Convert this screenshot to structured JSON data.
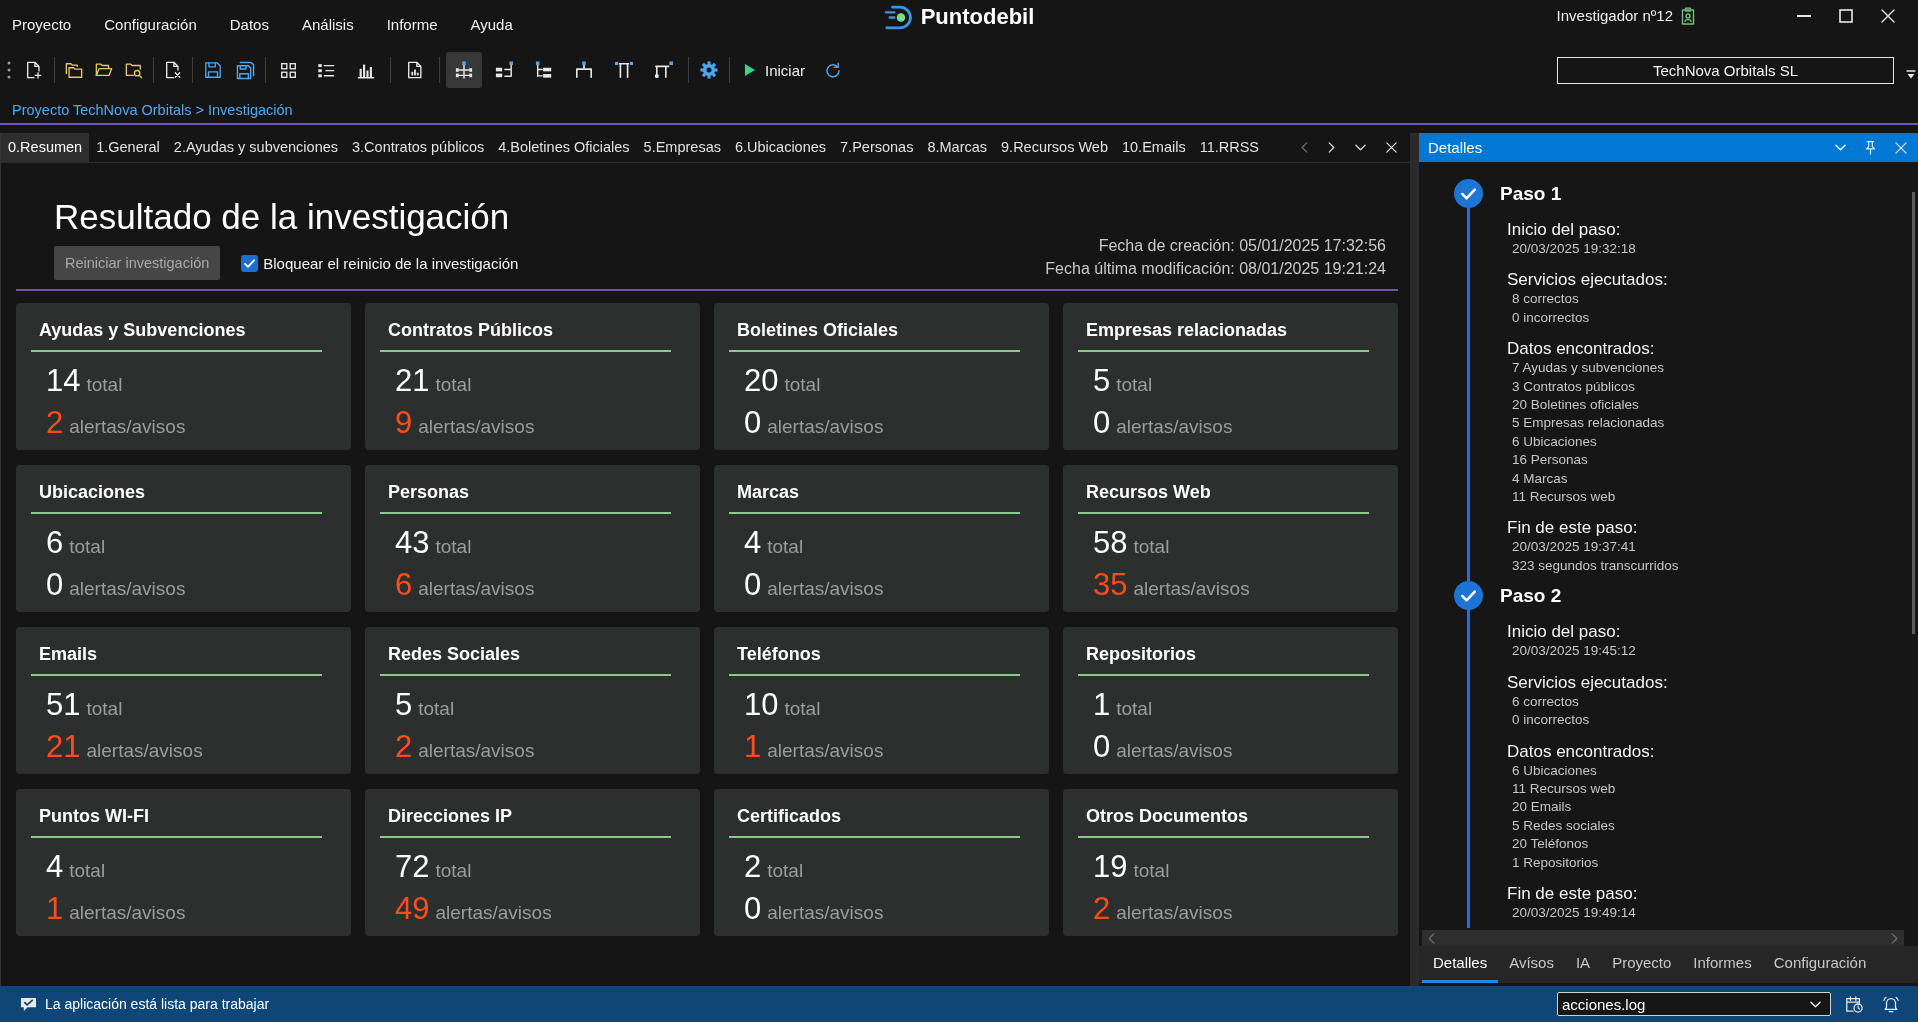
{
  "menu": [
    "Proyecto",
    "Configuración",
    "Datos",
    "Análisis",
    "Informe",
    "Ayuda"
  ],
  "logo": {
    "text": "Puntodebil"
  },
  "user": {
    "label": "Investigador nº12"
  },
  "toolbar": {
    "layout_buttons": [
      {
        "selected": true
      },
      {
        "selected": false
      },
      {
        "selected": false
      },
      {
        "selected": false
      },
      {
        "selected": false
      },
      {
        "selected": false
      }
    ],
    "start_button": {
      "label": "Iniciar"
    }
  },
  "company_selector": {
    "value": "TechNova Orbitals SL"
  },
  "breadcrumb": "Proyecto TechNova Orbitals > Investigación",
  "document_tabs": [
    {
      "label": "0.Resumen",
      "selected": true
    },
    {
      "label": "1.General",
      "selected": false
    },
    {
      "label": "2.Ayudas y subvenciones",
      "selected": false
    },
    {
      "label": "3.Contratos públicos",
      "selected": false
    },
    {
      "label": "4.Boletines Oficiales",
      "selected": false
    },
    {
      "label": "5.Empresas",
      "selected": false
    },
    {
      "label": "6.Ubicaciones",
      "selected": false
    },
    {
      "label": "7.Personas",
      "selected": false
    },
    {
      "label": "8.Marcas",
      "selected": false
    },
    {
      "label": "9.Recursos Web",
      "selected": false
    },
    {
      "label": "10.Emails",
      "selected": false
    },
    {
      "label": "11.RRSS",
      "selected": false
    }
  ],
  "summary": {
    "title": "Resultado de la investigación",
    "restart_button": {
      "label": "Reiniciar investigación",
      "disabled": true
    },
    "lock_checkbox": {
      "label": "Bloquear el reinicio de la investigación",
      "checked": true
    },
    "created": "Fecha de creación: 05/01/2025 17:32:56",
    "modified": "Fecha última modificación: 08/01/2025 19:21:24",
    "cards": [
      {
        "title": "Ayudas y Subvenciones",
        "total": "14",
        "total_label": "total",
        "alerts": "2",
        "alerts_label": "alertas/avisos",
        "warning": true
      },
      {
        "title": "Contratos Públicos",
        "total": "21",
        "total_label": "total",
        "alerts": "9",
        "alerts_label": "alertas/avisos",
        "warning": true
      },
      {
        "title": "Boletines Oficiales",
        "total": "20",
        "total_label": "total",
        "alerts": "0",
        "alerts_label": "alertas/avisos",
        "warning": false
      },
      {
        "title": "Empresas relacionadas",
        "total": "5",
        "total_label": "total",
        "alerts": "0",
        "alerts_label": "alertas/avisos",
        "warning": false
      },
      {
        "title": "Ubicaciones",
        "total": "6",
        "total_label": "total",
        "alerts": "0",
        "alerts_label": "alertas/avisos",
        "warning": false
      },
      {
        "title": "Personas",
        "total": "43",
        "total_label": "total",
        "alerts": "6",
        "alerts_label": "alertas/avisos",
        "warning": true
      },
      {
        "title": "Marcas",
        "total": "4",
        "total_label": "total",
        "alerts": "0",
        "alerts_label": "alertas/avisos",
        "warning": false
      },
      {
        "title": "Recursos Web",
        "total": "58",
        "total_label": "total",
        "alerts": "35",
        "alerts_label": "alertas/avisos",
        "warning": true
      },
      {
        "title": "Emails",
        "total": "51",
        "total_label": "total",
        "alerts": "21",
        "alerts_label": "alertas/avisos",
        "warning": true
      },
      {
        "title": "Redes Sociales",
        "total": "5",
        "total_label": "total",
        "alerts": "2",
        "alerts_label": "alertas/avisos",
        "warning": true
      },
      {
        "title": "Teléfonos",
        "total": "10",
        "total_label": "total",
        "alerts": "1",
        "alerts_label": "alertas/avisos",
        "warning": true
      },
      {
        "title": "Repositorios",
        "total": "1",
        "total_label": "total",
        "alerts": "0",
        "alerts_label": "alertas/avisos",
        "warning": false
      },
      {
        "title": "Puntos WI-FI",
        "total": "4",
        "total_label": "total",
        "alerts": "1",
        "alerts_label": "alertas/avisos",
        "warning": true
      },
      {
        "title": "Direcciones IP",
        "total": "72",
        "total_label": "total",
        "alerts": "49",
        "alerts_label": "alertas/avisos",
        "warning": true
      },
      {
        "title": "Certificados",
        "total": "2",
        "total_label": "total",
        "alerts": "0",
        "alerts_label": "alertas/avisos",
        "warning": false
      },
      {
        "title": "Otros Documentos",
        "total": "19",
        "total_label": "total",
        "alerts": "2",
        "alerts_label": "alertas/avisos",
        "warning": true
      }
    ]
  },
  "details_panel": {
    "title": "Detalles",
    "steps": [
      {
        "title": "Paso 1",
        "completed": true,
        "sections": [
          {
            "heading": "Inicio del paso:",
            "lines": [
              "20/03/2025 19:32:18"
            ]
          },
          {
            "heading": "Servicios ejecutados:",
            "lines": [
              "8 correctos",
              "0 incorrectos"
            ]
          },
          {
            "heading": "Datos encontrados:",
            "lines": [
              "7 Ayudas y subvenciones",
              "3 Contratos públicos",
              "20 Boletines oficiales",
              "5 Empresas relacionadas",
              "6 Ubicaciones",
              "16 Personas",
              "4 Marcas",
              "11 Recursos web"
            ]
          },
          {
            "heading": "Fin de este paso:",
            "lines": [
              "20/03/2025 19:37:41",
              "323 segundos transcurridos"
            ]
          }
        ]
      },
      {
        "title": "Paso 2",
        "completed": true,
        "sections": [
          {
            "heading": "Inicio del paso:",
            "lines": [
              "20/03/2025 19:45:12"
            ]
          },
          {
            "heading": "Servicios ejecutados:",
            "lines": [
              "6 correctos",
              "0 incorrectos"
            ]
          },
          {
            "heading": "Datos encontrados:",
            "lines": [
              "6 Ubicaciones",
              "11 Recursos web",
              "20 Emails",
              "5 Redes sociales",
              "20 Teléfonos",
              "1 Repositorios"
            ]
          },
          {
            "heading": "Fin de este paso:",
            "lines": [
              "20/03/2025 19:49:14"
            ]
          }
        ]
      }
    ],
    "tabs": [
      {
        "label": "Detalles",
        "selected": true
      },
      {
        "label": "Avísos",
        "selected": false
      },
      {
        "label": "IA",
        "selected": false
      },
      {
        "label": "Proyecto",
        "selected": false
      },
      {
        "label": "Informes",
        "selected": false
      },
      {
        "label": "Configuración",
        "selected": false
      }
    ]
  },
  "status_bar": {
    "message": "La aplicación está lista para trabajar",
    "log_selector": {
      "value": "acciones.log"
    }
  }
}
